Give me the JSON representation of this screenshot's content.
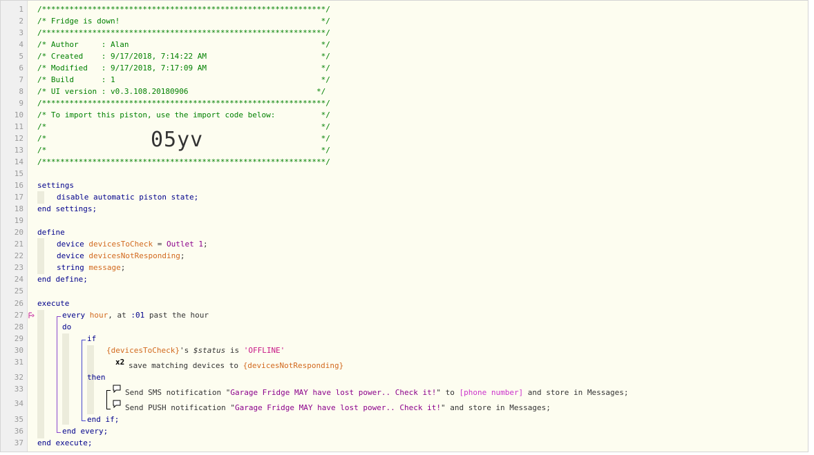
{
  "lines": [
    "1",
    "2",
    "3",
    "4",
    "5",
    "6",
    "7",
    "8",
    "9",
    "10",
    "11",
    "12",
    "13",
    "14",
    "15",
    "16",
    "17",
    "18",
    "19",
    "20",
    "21",
    "22",
    "23",
    "24",
    "25",
    "26",
    "27",
    "28",
    "29",
    "30",
    "31",
    "32",
    "33",
    "34",
    "35",
    "36",
    "37"
  ],
  "header": {
    "border": "/**************************************************************/",
    "title": "/* Fridge is down!                                            */",
    "author": "/* Author     : Alan                                          */",
    "created": "/* Created    : 9/17/2018, 7:14:22 AM                         */",
    "modified": "/* Modified   : 9/17/2018, 7:17:09 AM                         */",
    "build": "/* Build      : 1                                             */",
    "ui_version": "/* UI version : v0.3.108.20180906                            */",
    "import_hint": "/* To import this piston, use the import code below:          */",
    "blank": "/*                                                            */",
    "import_code": "05yv"
  },
  "settings": {
    "open": "settings",
    "line": "disable automatic piston state;",
    "close": "end settings;"
  },
  "define": {
    "open": "define",
    "var1": {
      "type": "device",
      "name": "devicesToCheck",
      "eq": " = ",
      "value": "Outlet 1",
      "semi": ";"
    },
    "var2": {
      "type": "device",
      "name": "devicesNotResponding",
      "semi": ";"
    },
    "var3": {
      "type": "string",
      "name": "message",
      "semi": ";"
    },
    "close": "end define;"
  },
  "execute": {
    "open": "execute",
    "every": "every",
    "hour": "hour",
    "at": ", at ",
    "time": ":01",
    "past": " past the hour",
    "do": "do",
    "if": "if",
    "cond_var": "{devicesToCheck}",
    "cond_s": "'s ",
    "cond_attr": "$status",
    "cond_is": " is ",
    "cond_val": "'OFFLINE'",
    "multiplier": "x2",
    "save_text": "save matching devices to ",
    "save_var": "{devicesNotResponding}",
    "then": "then",
    "sms_pre": "Send SMS notification \"",
    "sms_msg": "Garage Fridge MAY have lost power.. Check it!",
    "sms_mid": "\" to ",
    "sms_phone": "[phone number]",
    "sms_post": " and store in Messages;",
    "push_pre": "Send PUSH notification \"",
    "push_msg": "Garage Fridge MAY have lost power.. Check it!",
    "push_post": "\" and store in Messages;",
    "end_if": "end if;",
    "end_every": "end every;",
    "close": "end execute;"
  }
}
